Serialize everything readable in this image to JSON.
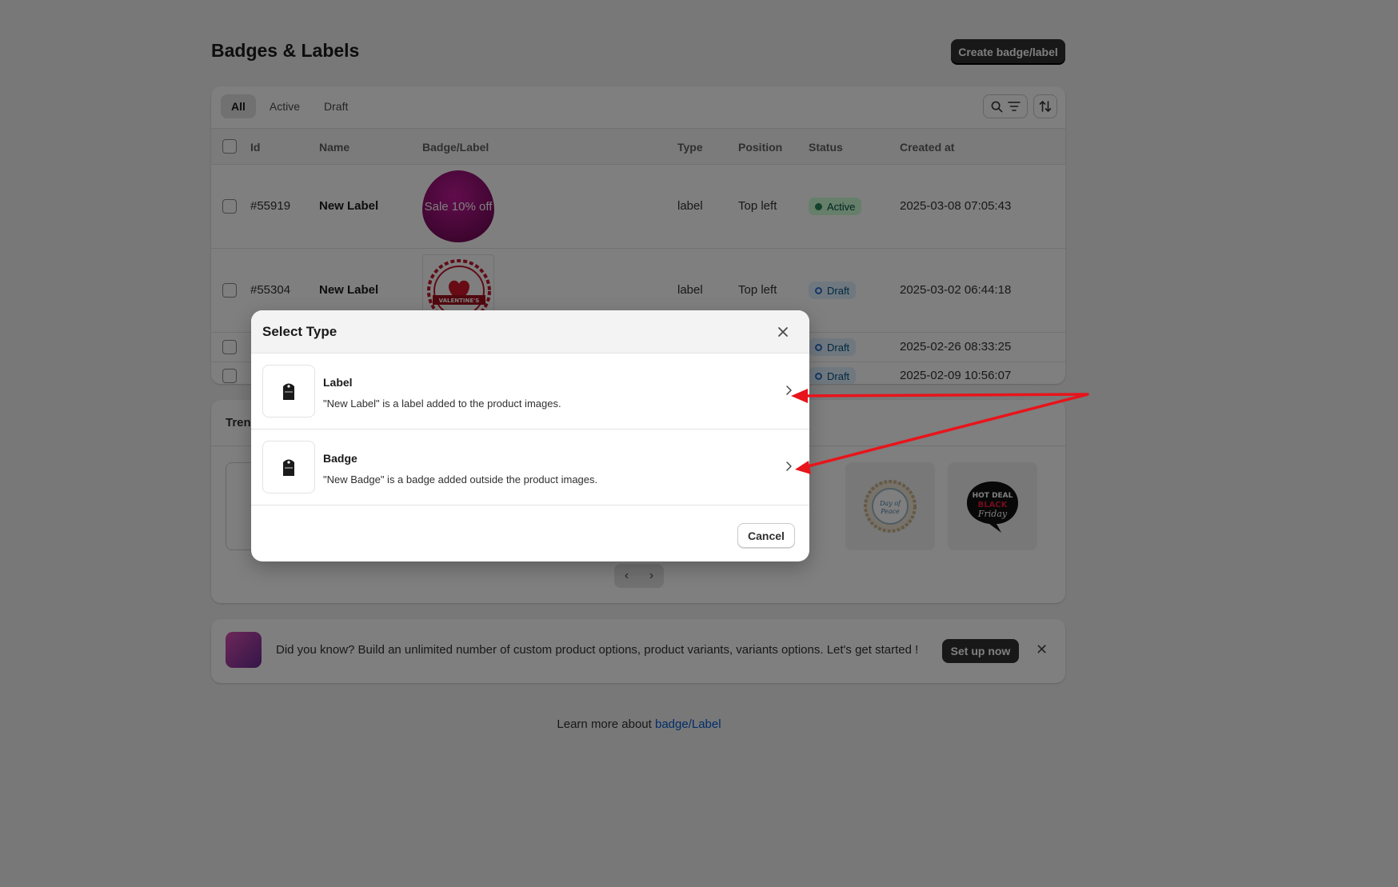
{
  "page": {
    "title": "Badges & Labels",
    "create_button": "Create badge/label"
  },
  "tabs": [
    {
      "label": "All"
    },
    {
      "label": "Active"
    },
    {
      "label": "Draft"
    }
  ],
  "table": {
    "headers": {
      "id": "Id",
      "name": "Name",
      "badge": "Badge/Label",
      "type": "Type",
      "position": "Position",
      "status": "Status",
      "created": "Created at"
    },
    "rows": [
      {
        "id": "#55919",
        "name": "New Label",
        "badge_text": "Sale 10% off",
        "type": "label",
        "position": "Top left",
        "status": "Active",
        "created": "2025-03-08 07:05:43"
      },
      {
        "id": "#55304",
        "name": "New Label",
        "badge_text": "HAPPY VALENTINE'S DAY",
        "type": "label",
        "position": "Top left",
        "status": "Draft",
        "created": "2025-03-02 06:44:18"
      },
      {
        "status": "Draft",
        "created": "2025-02-26 08:33:25"
      },
      {
        "status": "Draft",
        "created": "2025-02-09 10:56:07"
      }
    ]
  },
  "trending": {
    "title": "Tren",
    "tiles": [
      {
        "icon": "peace-badge-icon",
        "text": "Day of Peace"
      },
      {
        "icon": "black-friday-bubble-icon",
        "text_lines": [
          "HOT DEAL",
          "BLACK",
          "Friday"
        ]
      }
    ]
  },
  "banner": {
    "text": "Did you know? Build an unlimited number of custom product options, product variants, variants options. Let's get started !",
    "button": "Set up now"
  },
  "footer": {
    "prefix": "Learn more about ",
    "link": "badge/Label"
  },
  "modal": {
    "title": "Select Type",
    "options": [
      {
        "title": "Label",
        "desc": "\"New Label\" is a label added to the product images."
      },
      {
        "title": "Badge",
        "desc": "\"New Badge\" is a badge added outside the product images."
      }
    ],
    "cancel": "Cancel"
  },
  "colors": {
    "accent_dark": "#303030",
    "annotation_arrow": "#e8141b",
    "active_badge": "#cdfed4",
    "draft_badge": "#e0f0ff",
    "link": "#005bd3"
  }
}
